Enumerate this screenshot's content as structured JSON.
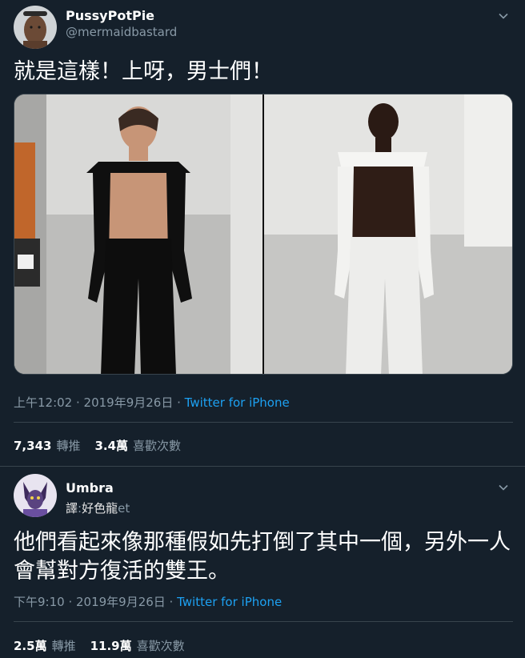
{
  "tweet1": {
    "display_name": "PussyPotPie",
    "handle": "@mermaidbastard",
    "text": "就是這樣！上呀，男士們！",
    "time": "上午12:02 · 2019年9月26日 · ",
    "source": "Twitter for iPhone",
    "retweets_count": "7,343",
    "retweets_label": "轉推",
    "likes_count": "3.4萬",
    "likes_label": "喜歡次數"
  },
  "tweet2": {
    "display_name": "Umbra",
    "translate_label": "譯",
    "translate_ghost": ":",
    "translate_text": "好色龍",
    "translate_tail": "et",
    "text": "他們看起來像那種假如先打倒了其中一個，另外一人會幫對方復活的雙王。",
    "time": "下午9:10 · 2019年9月26日 · ",
    "source": "Twitter for iPhone",
    "retweets_count": "2.5萬",
    "retweets_label": "轉推",
    "likes_count": "11.9萬",
    "likes_label": "喜歡次數"
  },
  "colors": {
    "background": "#15202b",
    "secondary_text": "#8899a6",
    "link": "#1da1f2",
    "divider": "#38444d"
  },
  "icons": [
    "chevron-down-icon",
    "avatar"
  ]
}
